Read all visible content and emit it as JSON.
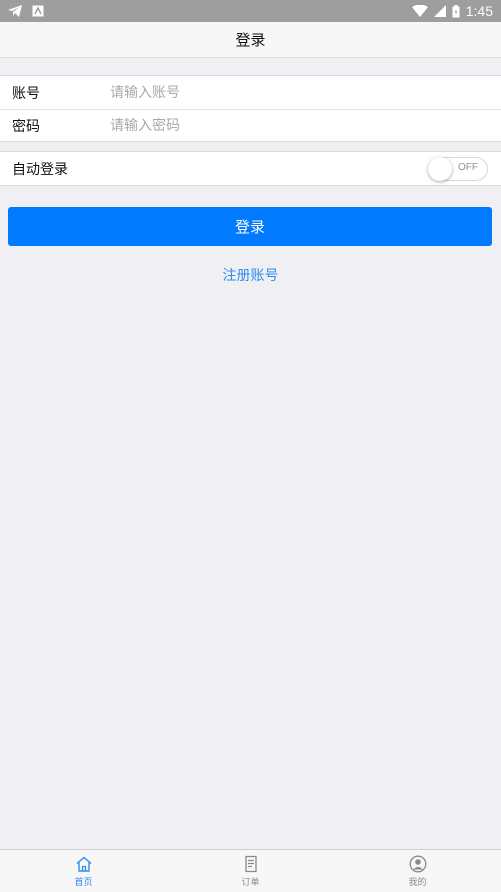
{
  "status_bar": {
    "time": "1:45",
    "icons": [
      "telegram-send-icon",
      "app-notification-icon",
      "wifi-icon",
      "cell-signal-icon",
      "battery-icon"
    ]
  },
  "nav": {
    "title": "登录"
  },
  "form": {
    "account": {
      "label": "账号",
      "placeholder": "请输入账号",
      "value": ""
    },
    "password": {
      "label": "密码",
      "placeholder": "请输入密码",
      "value": ""
    }
  },
  "auto_login": {
    "label": "自动登录",
    "state": "OFF"
  },
  "actions": {
    "login_label": "登录",
    "register_label": "注册账号"
  },
  "tab_bar": {
    "items": [
      {
        "label": "首页",
        "icon": "home-icon",
        "active": true
      },
      {
        "label": "订单",
        "icon": "order-list-icon",
        "active": false
      },
      {
        "label": "我的",
        "icon": "user-profile-icon",
        "active": false
      }
    ]
  },
  "colors": {
    "primary": "#007aff",
    "link": "#2d8cf0",
    "background": "#efeff4",
    "status_bar": "#9e9e9e",
    "tab_inactive": "#8a8a8a"
  }
}
